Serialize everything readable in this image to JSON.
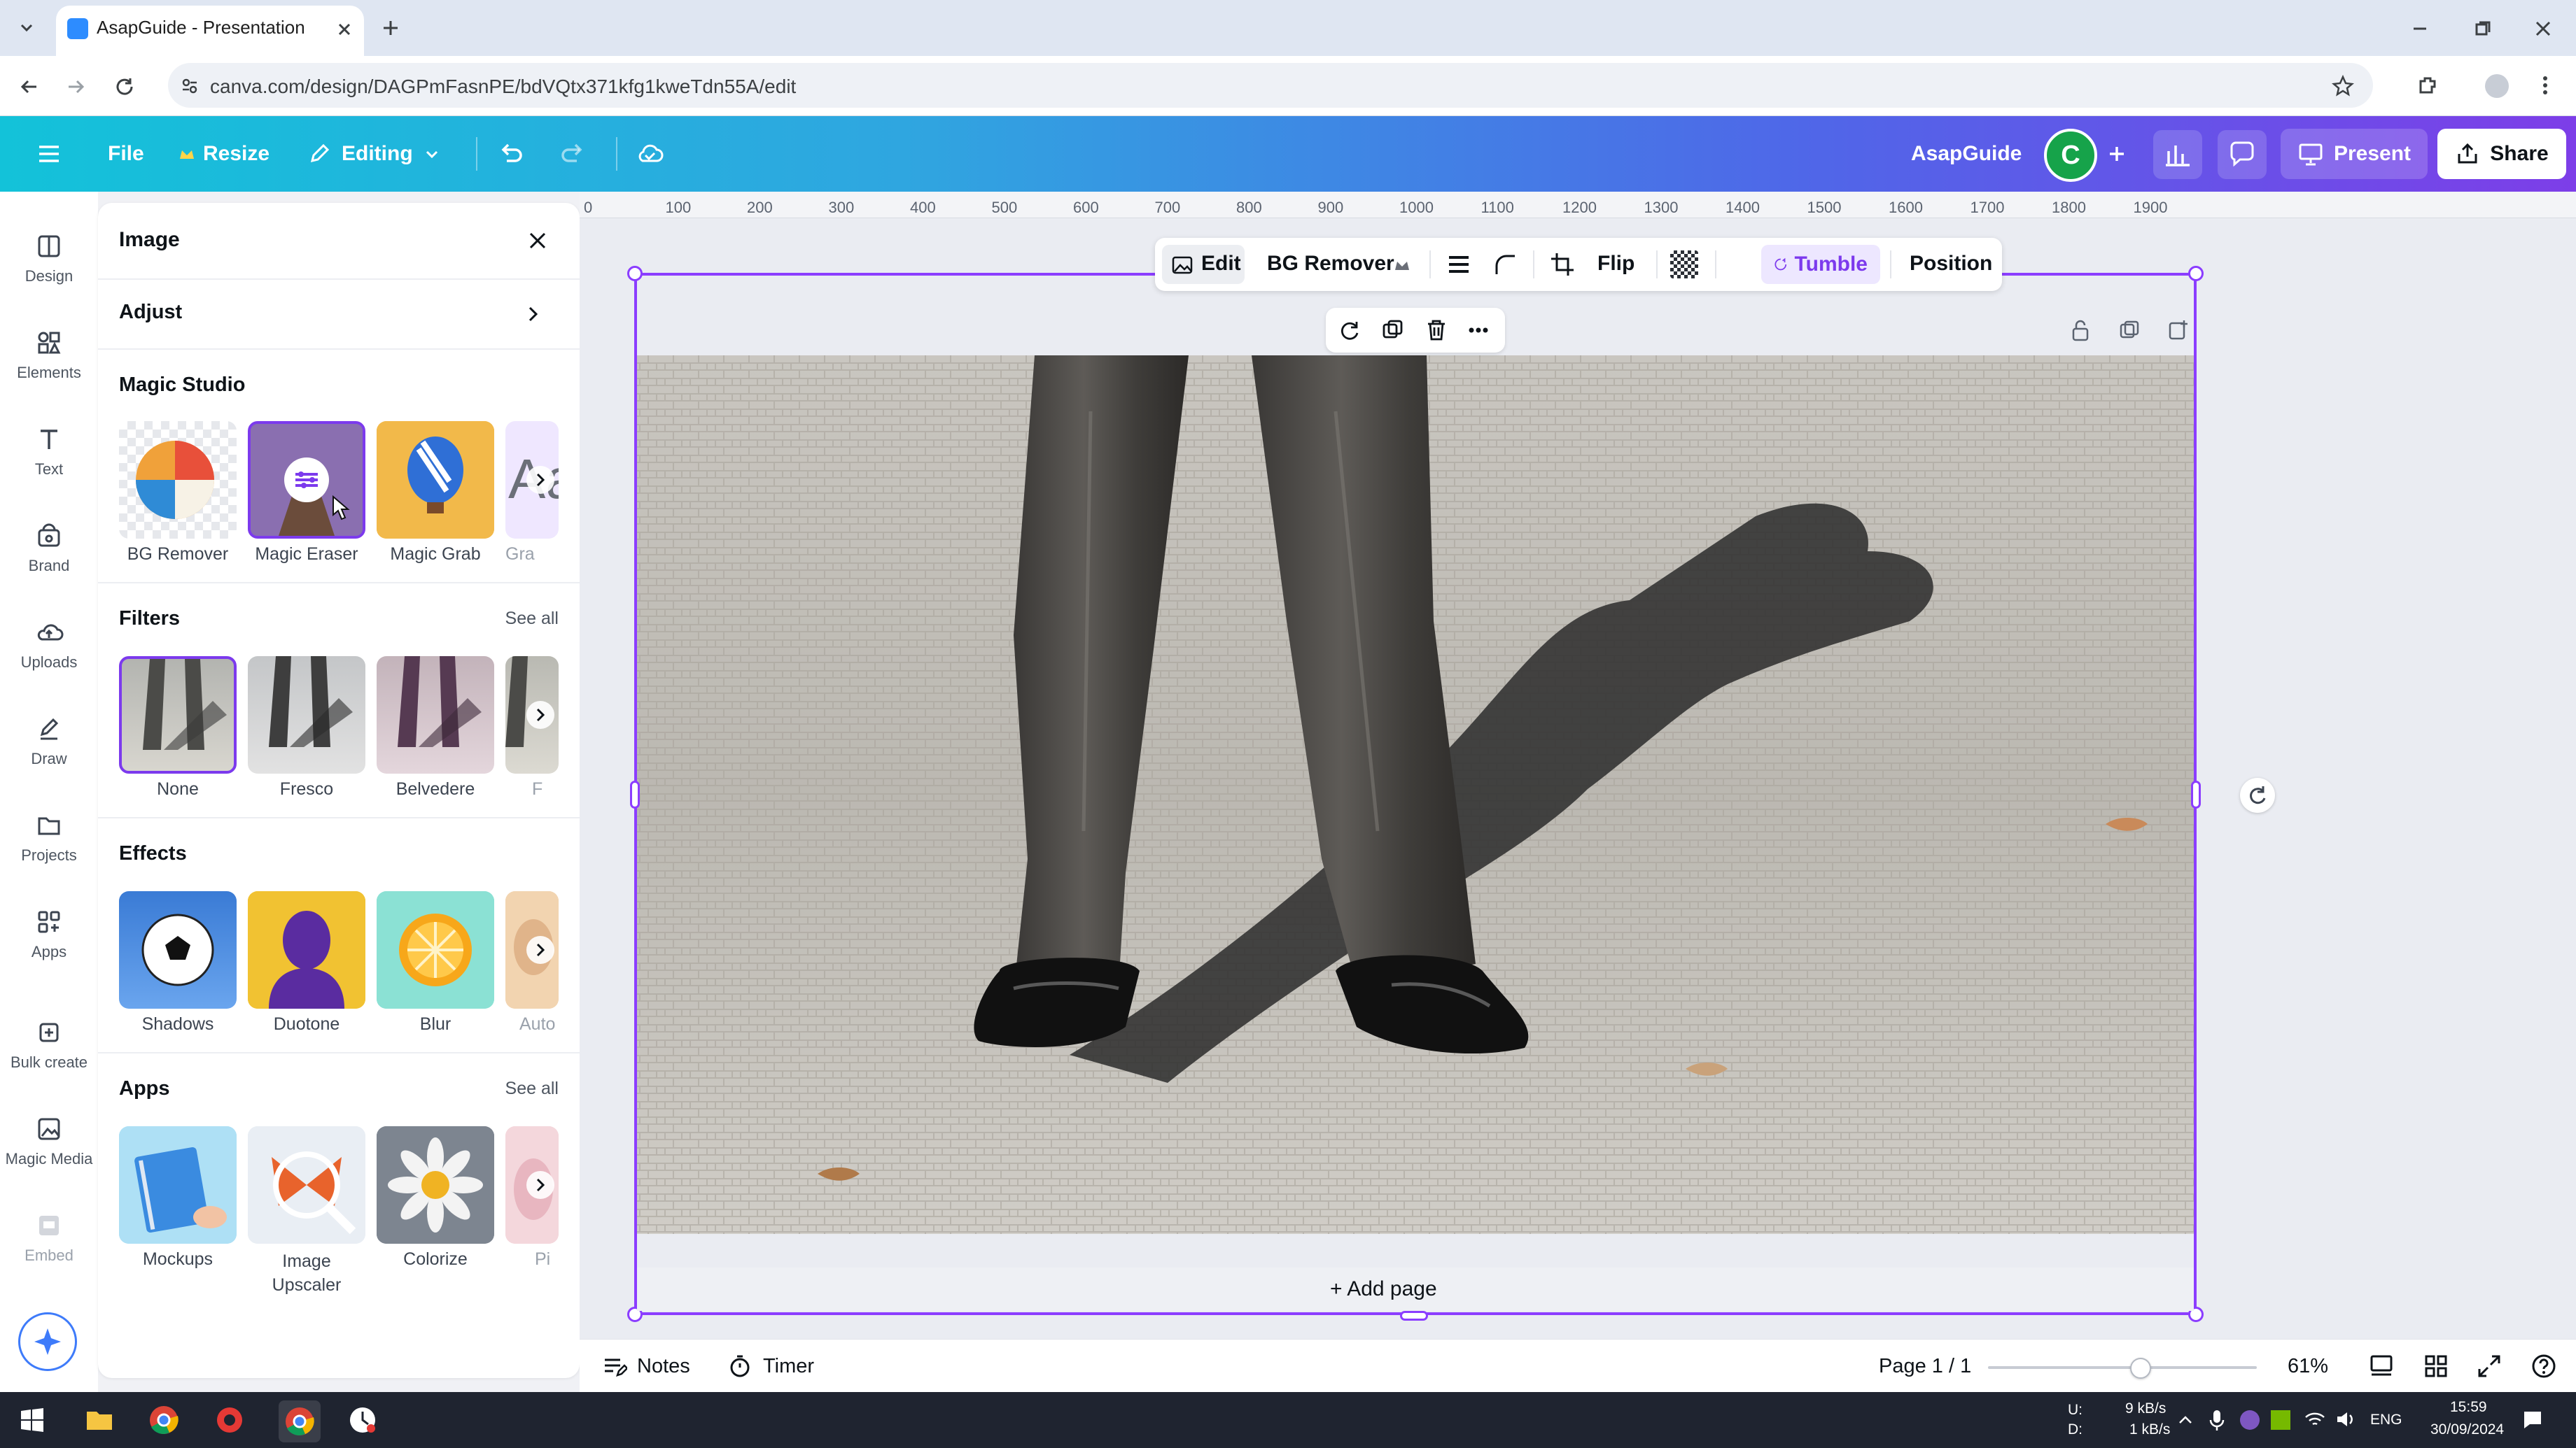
{
  "browser": {
    "tab_title": "AsapGuide - Presentation",
    "url": "canva.com/design/DAGPmFasnPE/bdVQtx371kfg1kweTdn55A/edit"
  },
  "header": {
    "file": "File",
    "resize": "Resize",
    "editing": "Editing",
    "brand_name": "AsapGuide",
    "avatar_letter": "C",
    "present": "Present",
    "share": "Share"
  },
  "rail": {
    "items": [
      {
        "label": "Design",
        "icon": "design-icon"
      },
      {
        "label": "Elements",
        "icon": "elements-icon"
      },
      {
        "label": "Text",
        "icon": "text-icon"
      },
      {
        "label": "Brand",
        "icon": "brand-icon"
      },
      {
        "label": "Uploads",
        "icon": "uploads-icon"
      },
      {
        "label": "Draw",
        "icon": "draw-icon"
      },
      {
        "label": "Projects",
        "icon": "projects-icon"
      },
      {
        "label": "Apps",
        "icon": "apps-icon"
      },
      {
        "label": "Bulk create",
        "icon": "bulk-create-icon"
      },
      {
        "label": "Magic Media",
        "icon": "magic-media-icon"
      },
      {
        "label": "Embed",
        "icon": "embed-icon"
      }
    ]
  },
  "panel": {
    "title": "Image",
    "adjust": "Adjust",
    "magic_studio": {
      "title": "Magic Studio",
      "items": [
        "BG Remover",
        "Magic Eraser",
        "Magic Grab",
        "Gra"
      ]
    },
    "filters": {
      "title": "Filters",
      "see_all": "See all",
      "items": [
        "None",
        "Fresco",
        "Belvedere",
        "F"
      ]
    },
    "effects": {
      "title": "Effects",
      "items": [
        "Shadows",
        "Duotone",
        "Blur",
        "Auto"
      ]
    },
    "apps": {
      "title": "Apps",
      "see_all": "See all",
      "items": [
        "Mockups",
        "Image Upscaler",
        "Colorize",
        "Pi"
      ]
    }
  },
  "ruler": {
    "ticks": [
      "0",
      "100",
      "200",
      "300",
      "400",
      "500",
      "600",
      "700",
      "800",
      "900",
      "1000",
      "1100",
      "1200",
      "1300",
      "1400",
      "1500",
      "1600",
      "1700",
      "1800",
      "1900"
    ]
  },
  "context_toolbar": {
    "edit": "Edit",
    "bg_remover": "BG Remover",
    "flip": "Flip",
    "tumble": "Tumble",
    "position": "Position"
  },
  "canvas": {
    "add_page": "+ Add page"
  },
  "footer": {
    "notes": "Notes",
    "timer": "Timer",
    "page": "Page 1 / 1",
    "zoom": "61%",
    "zoom_level": 0.61
  },
  "taskbar": {
    "net_up_label": "U:",
    "net_down_label": "D:",
    "net_up": "9 kB/s",
    "net_down": "1 kB/s",
    "lang": "ENG",
    "time": "15:59",
    "date": "30/09/2024"
  }
}
